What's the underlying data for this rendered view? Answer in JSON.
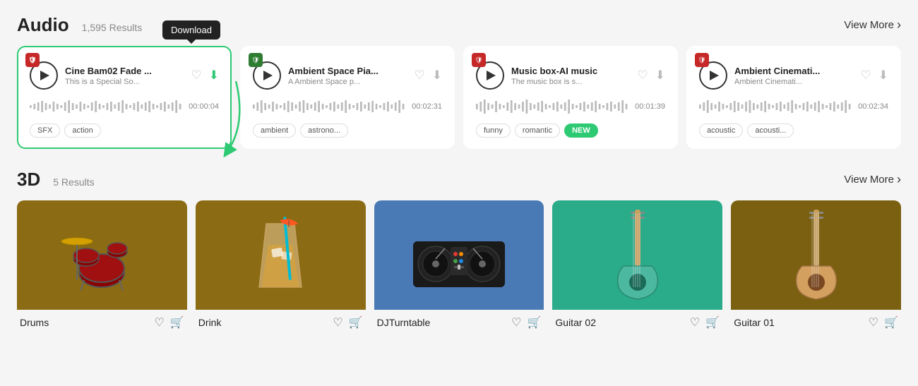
{
  "audio_section": {
    "title": "Audio",
    "count": "1,595 Results",
    "view_more": "View More",
    "tooltip": "Download",
    "cards": [
      {
        "id": "card1",
        "highlighted": true,
        "title": "Cine Bam02 Fade ...",
        "subtitle": "This is a Special So...",
        "duration": "00:00:04",
        "tags": [
          "SFX",
          "action"
        ]
      },
      {
        "id": "card2",
        "highlighted": false,
        "title": "Ambient Space Pia...",
        "subtitle": "A Ambient Space p...",
        "duration": "00:02:31",
        "tags": [
          "ambient",
          "astrono..."
        ]
      },
      {
        "id": "card3",
        "highlighted": false,
        "title": "Music box-AI music",
        "subtitle": "The music box is s...",
        "duration": "00:01:39",
        "tags": [
          "funny",
          "romantic",
          "NEW"
        ]
      },
      {
        "id": "card4",
        "highlighted": false,
        "title": "Ambient Cinemati...",
        "subtitle": "Ambient Cinemati...",
        "duration": "00:02:34",
        "tags": [
          "acoustic",
          "acousti..."
        ]
      }
    ]
  },
  "three_d_section": {
    "title": "3D",
    "count": "5 Results",
    "view_more": "View More",
    "items": [
      {
        "name": "Drums",
        "bg": "#8B6B14"
      },
      {
        "name": "Drink",
        "bg": "#8B6B14"
      },
      {
        "name": "DJTurntable",
        "bg": "#4a7ab5"
      },
      {
        "name": "Guitar 02",
        "bg": "#2aab8a"
      },
      {
        "name": "Guitar 01",
        "bg": "#7a6010"
      }
    ]
  }
}
